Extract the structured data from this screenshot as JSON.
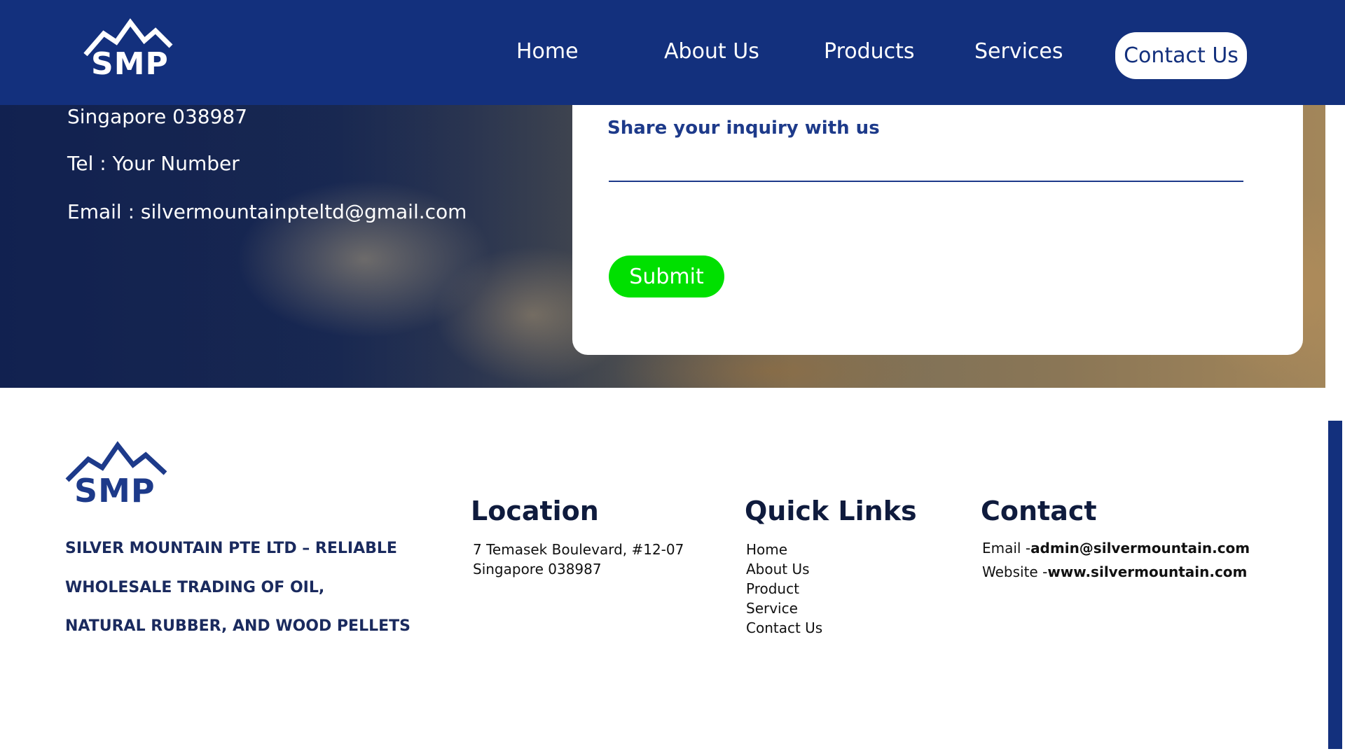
{
  "header": {
    "logo_text": "SMP",
    "nav": [
      "Home",
      "About Us",
      "Products",
      "Services",
      "Contact Us"
    ]
  },
  "hero": {
    "address_line": "Singapore 038987",
    "tel": "Tel : Your Number",
    "email": "Email : silvermountainpteltd@gmail.com"
  },
  "form": {
    "label": "Share your inquiry with us",
    "submit_label": "Submit"
  },
  "footer": {
    "logo_text": "SMP",
    "tagline": [
      "SILVER MOUNTAIN PTE LTD – RELIABLE",
      "WHOLESALE TRADING OF OIL,",
      "NATURAL RUBBER, AND WOOD PELLETS"
    ],
    "location": {
      "heading": "Location",
      "lines": [
        "7 Temasek Boulevard, #12-07",
        "Singapore 038987"
      ]
    },
    "quick_links": {
      "heading": "Quick Links",
      "items": [
        "Home",
        "About Us",
        "Product",
        "Service",
        "Contact Us"
      ]
    },
    "contact": {
      "heading": "Contact",
      "email_label": "Email -",
      "email_value": "admin@silvermountain.com",
      "website_label": "Website -",
      "website_value": "www.silvermountain.com"
    }
  },
  "colors": {
    "primary": "#13307d",
    "submit": "#00e000"
  }
}
